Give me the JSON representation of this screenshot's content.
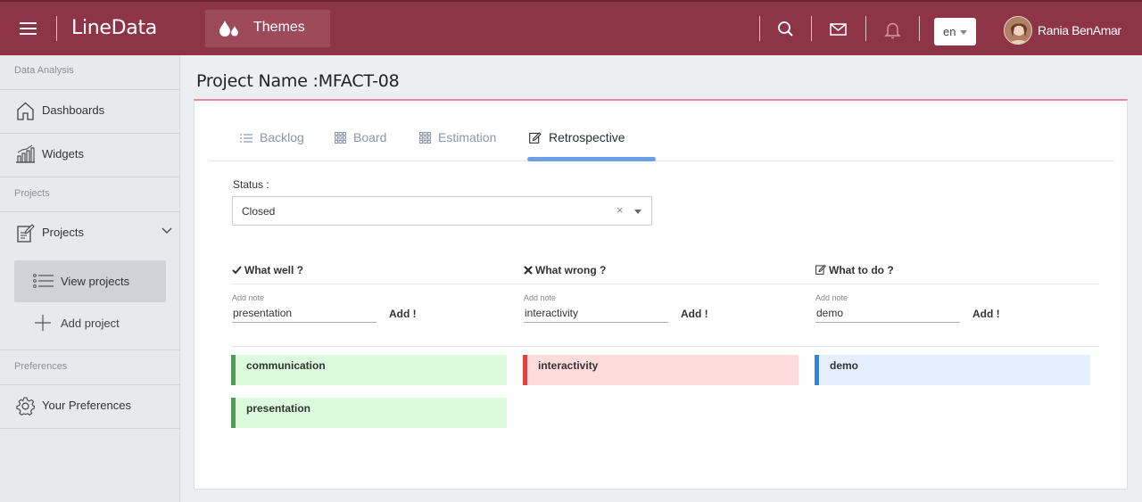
{
  "header": {
    "app_name": "LineData",
    "themes_label": "Themes",
    "language": "en",
    "user_name": "Rania BenAmar",
    "brand_color": "#8d3447"
  },
  "sidebar": {
    "section_data_analysis": "Data Analysis",
    "dashboards": "Dashboards",
    "widgets": "Widgets",
    "section_projects": "Projects",
    "projects": "Projects",
    "view_projects": "View projects",
    "add_project": "Add project",
    "section_preferences": "Preferences",
    "your_preferences": "Your Preferences"
  },
  "page": {
    "title": "Project Name :MFACT-08",
    "tabs": [
      {
        "label": "Backlog",
        "icon": "list-icon"
      },
      {
        "label": "Board",
        "icon": "grid-icon"
      },
      {
        "label": "Estimation",
        "icon": "grid-icon"
      },
      {
        "label": "Retrospective",
        "icon": "edit-icon",
        "active": true
      }
    ],
    "status_label": "Status :",
    "status_value": "Closed",
    "columns": [
      {
        "title": "What well ?",
        "icon": "check-icon",
        "note_label": "Add note",
        "note_value": "presentation",
        "add_label": "Add !"
      },
      {
        "title": "What wrong ?",
        "icon": "times-icon",
        "note_label": "Add note",
        "note_value": "interactivity",
        "add_label": "Add !"
      },
      {
        "title": "What to do ?",
        "icon": "edit-icon",
        "note_label": "Add note",
        "note_value": "demo",
        "add_label": "Add !"
      }
    ],
    "well_notes": [
      "communication",
      "presentation"
    ],
    "wrong_notes": [
      "interactivity"
    ],
    "todo_notes": [
      "demo"
    ]
  },
  "colors": {
    "good": "#4c9f51",
    "bad": "#de4343",
    "todo": "#2e86d8",
    "tab_accent": "#6d9ee8"
  }
}
